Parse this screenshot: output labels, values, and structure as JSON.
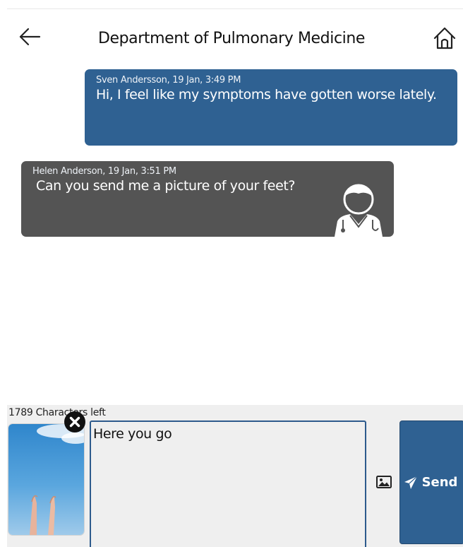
{
  "header": {
    "title": "Department of Pulmonary Medicine",
    "back_icon": "arrow-left-icon",
    "home_icon": "home-icon"
  },
  "messages": [
    {
      "sender": "Sven Andersson",
      "meta": "Sven Andersson, 19 Jan, 3:49 PM",
      "text": "Hi, I feel like my symptoms have gotten worse lately.",
      "role": "patient",
      "bubble_color": "#2f6192"
    },
    {
      "sender": "Helen Anderson",
      "meta": "Helen Anderson, 19 Jan, 3:51 PM",
      "text": "Can you send me a picture of your feet?",
      "role": "doctor",
      "bubble_color": "#545454",
      "avatar_icon": "doctor-avatar-icon"
    }
  ],
  "composer": {
    "char_counter": "1789 Characters left",
    "input_value": "Here you go",
    "attachment_icon": "photo-thumbnail",
    "remove_icon": "close-circle-icon",
    "image_icon": "image-icon",
    "send_label": "Send",
    "send_icon": "paper-plane-icon",
    "accent_color": "#2f6192"
  }
}
